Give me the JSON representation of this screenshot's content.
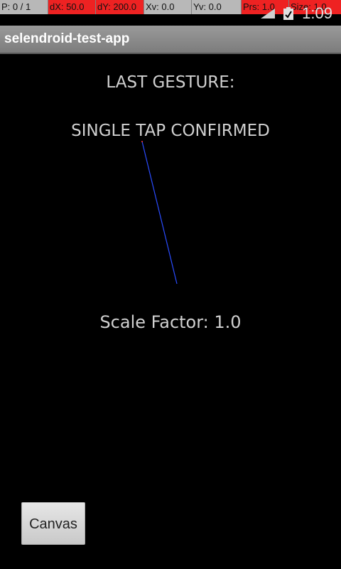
{
  "pointer_overlay": {
    "pointers": "P: 0 / 1",
    "dx": "dX: 50.0",
    "dy": "dY: 200.0",
    "xv": "Xv: 0.0",
    "yv": "Yv: 0.0",
    "pressure": "Prs: 1.0",
    "size": "Size: 1.0",
    "alert_color": "#ee2222"
  },
  "status_bar": {
    "time": "1:09",
    "icons": [
      "signal-icon",
      "battery-icon"
    ]
  },
  "action_bar": {
    "title": "selendroid-test-app"
  },
  "main": {
    "last_gesture_label": "LAST GESTURE:",
    "gesture_value": "SINGLE TAP CONFIRMED",
    "scale_factor": "Scale Factor: 1.0",
    "trace_color": "#2a4cff"
  },
  "canvas_button": {
    "label": "Canvas"
  }
}
